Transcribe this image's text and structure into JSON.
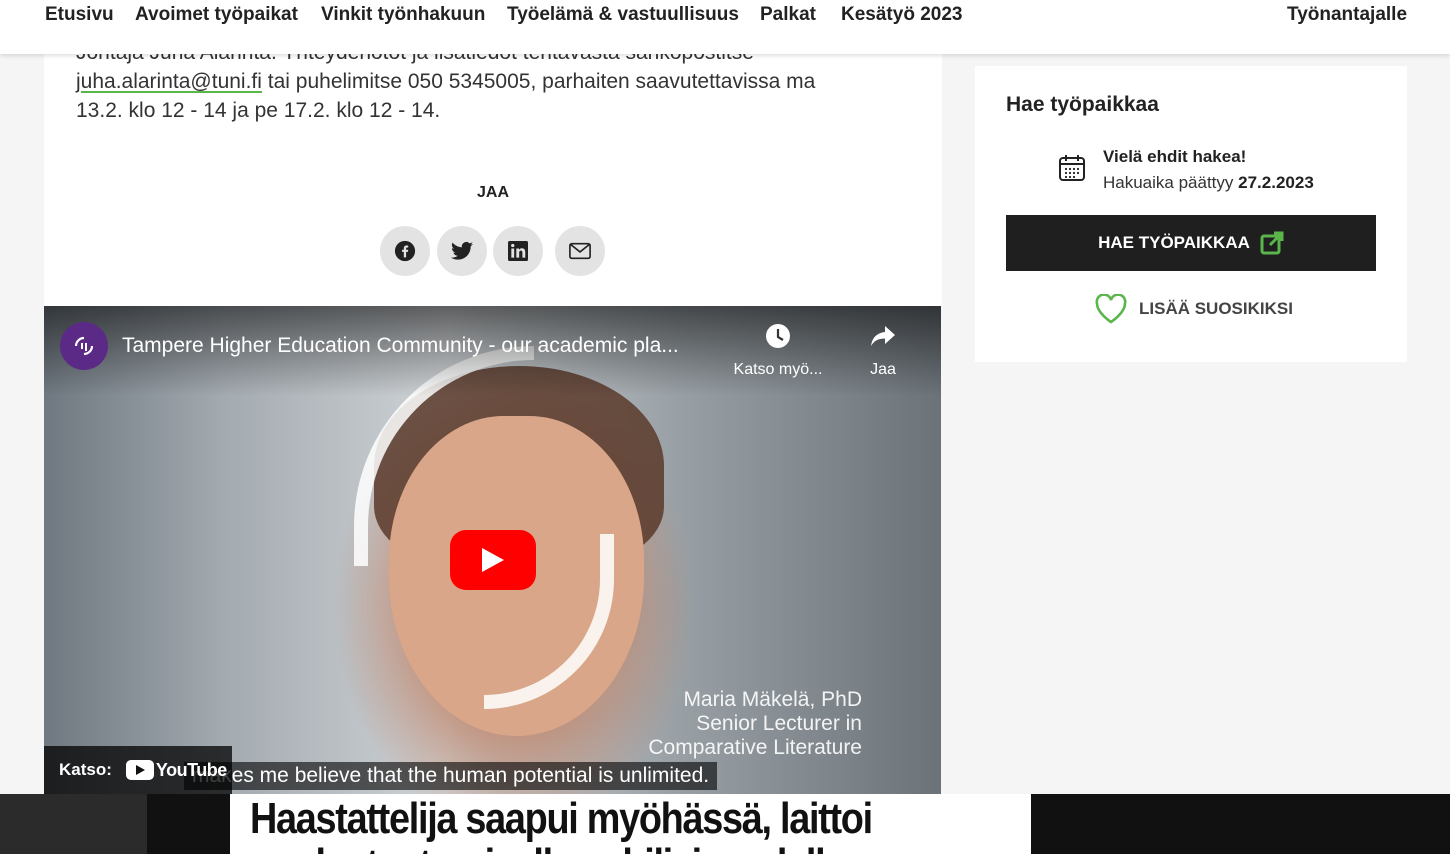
{
  "nav": {
    "items": [
      "Etusivu",
      "Avoimet työpaikat",
      "Vinkit työnhakuun",
      "Työelämä & vastuullisuus",
      "Palkat",
      "Kesätyö 2023"
    ],
    "employer": "Työnantajalle"
  },
  "article": {
    "text_line1": "Johtaja Juha Alarinta. Yhteydenotot ja lisätiedot tentävasta sähköpostitse",
    "email": "juha.alarinta@tuni.fi",
    "text_line2_rest": " tai puhelimitse 050 5345005, parhaiten saavutettavissa ma",
    "text_line3": "13.2. klo 12 - 14 ja pe 17.2. klo 12 - 14.",
    "share_title": "JAA"
  },
  "share": {
    "icons": [
      "facebook-icon",
      "twitter-icon",
      "linkedin-icon",
      "mail-icon"
    ]
  },
  "video": {
    "title": "Tampere Higher Education Community - our academic pla...",
    "watch_later": "Katso myö...",
    "share": "Jaa",
    "caption_line1": "Maria Mäkelä, PhD",
    "caption_line2": "Senior Lecturer in",
    "caption_line3": "Comparative Literature",
    "subtitle": "makes me believe that the human potential is unlimited.",
    "watch_on": "Katso:",
    "youtube": "YouTube"
  },
  "sidebar": {
    "title": "Hae työpaikkaa",
    "still_time": "Vielä ehdit hakea!",
    "deadline_label": "Hakuaika päättyy ",
    "deadline_date": "27.2.2023",
    "apply_button": "HAE TYÖPAIKKAA",
    "favorite": "LISÄÄ SUOSIKIKSI"
  },
  "bottom": {
    "headline": "Haastattelija saapui myöhässä, laittoi",
    "headline_line2": "puolustautumiselleen hiljaisuudella"
  },
  "colors": {
    "accent_green": "#5ab54b",
    "youtube_red": "#ff0000",
    "button_dark": "#1f1f1f"
  }
}
